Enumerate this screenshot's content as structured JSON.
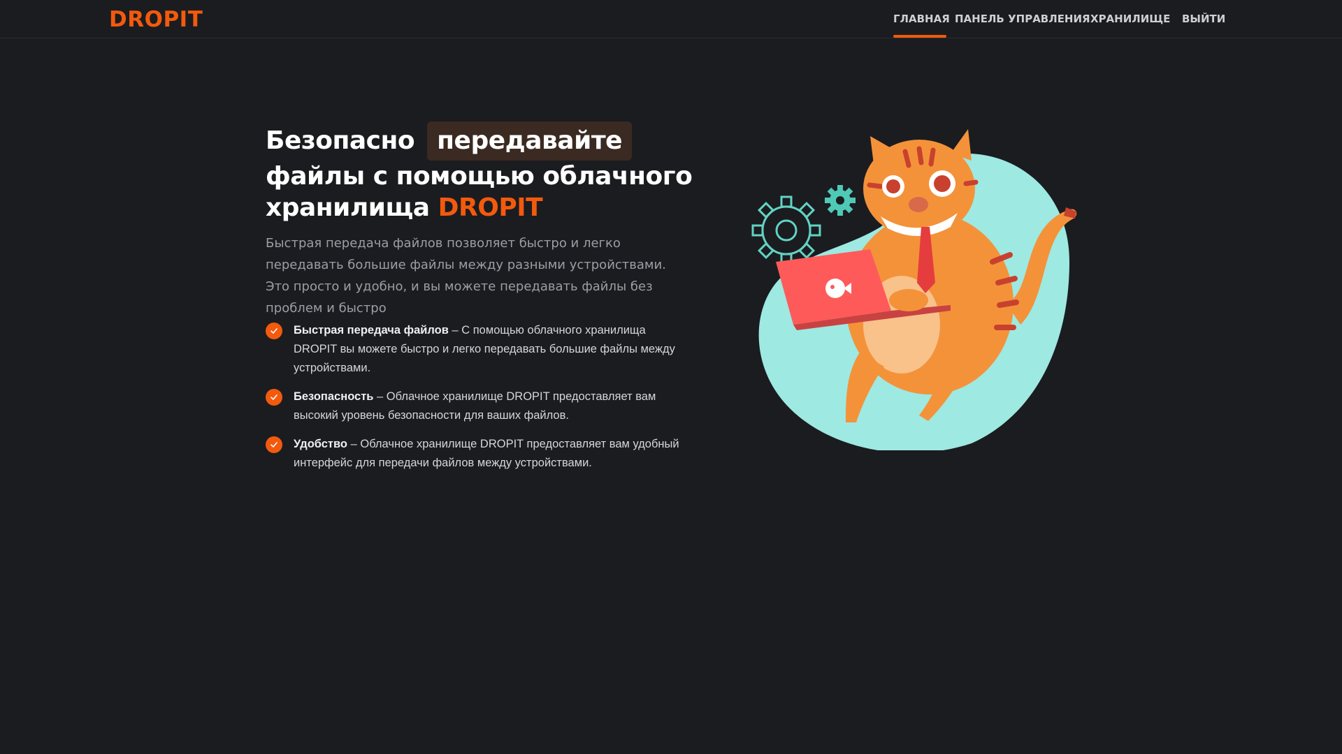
{
  "header": {
    "logo": "DROPIT",
    "nav": [
      {
        "label": "ГЛАВНАЯ",
        "active": true
      },
      {
        "label": "ПАНЕЛЬ УПРАВЛЕНИЯ",
        "active": false
      },
      {
        "label": "ХРАНИЛИЩЕ",
        "active": false
      },
      {
        "label": "ВЫЙТИ",
        "active": false
      }
    ]
  },
  "hero": {
    "title_part1": "Безопасно",
    "title_highlight": "передавайте",
    "title_part2": "файлы с помощью облачного хранилища",
    "title_brand": "DROPIT",
    "lead": "Быстрая передача файлов позволяет быстро и легко передавать большие файлы между разными устройствами. Это просто и удобно, и вы можете передавать файлы без проблем и быстро"
  },
  "features": [
    {
      "title": "Быстрая передача файлов",
      "text": " – С помощью облачного хранилища DROPIT вы можете быстро и легко передавать большие файлы между устройствами."
    },
    {
      "title": "Безопасность",
      "text": " – Облачное хранилище DROPIT предоставляет вам высокий уровень безопасности для ваших файлов."
    },
    {
      "title": "Удобство",
      "text": " – Облачное хранилище DROPIT предоставляет вам удобный интерфейс для передачи файлов между устройствами."
    }
  ],
  "colors": {
    "accent": "#f25a0d",
    "background": "#1b1c20",
    "highlight_bg": "#3a2a22",
    "teal": "#9ee9e2"
  },
  "icons": {
    "check": "check-circle-icon",
    "illustration": "cat-with-laptop-illustration"
  }
}
